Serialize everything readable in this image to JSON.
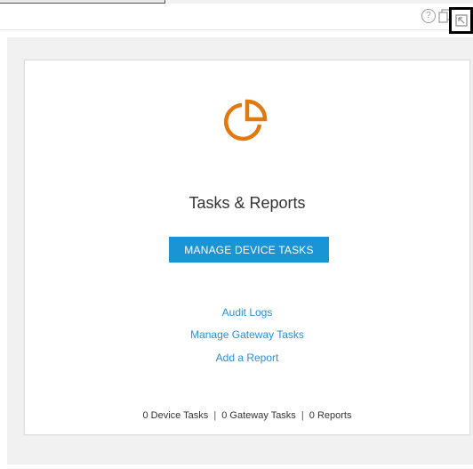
{
  "toolbar": {
    "help_icon": "help-icon",
    "help_glyph": "?",
    "copy_icon": "copy-icon",
    "expand_icon": "expand-icon"
  },
  "card": {
    "icon": "pie-chart-icon",
    "icon_color": "#e07a10",
    "title": "Tasks & Reports",
    "primary_button": "MANAGE DEVICE TASKS",
    "primary_color": "#1b94d6",
    "links": {
      "audit_logs": "Audit Logs",
      "manage_gateway_tasks": "Manage Gateway Tasks",
      "add_report": "Add a Report"
    },
    "link_color": "#2a8fd8",
    "summary": {
      "device_tasks": "0 Device Tasks",
      "gateway_tasks": "0 Gateway Tasks",
      "reports": "0 Reports",
      "separator": "|"
    }
  }
}
